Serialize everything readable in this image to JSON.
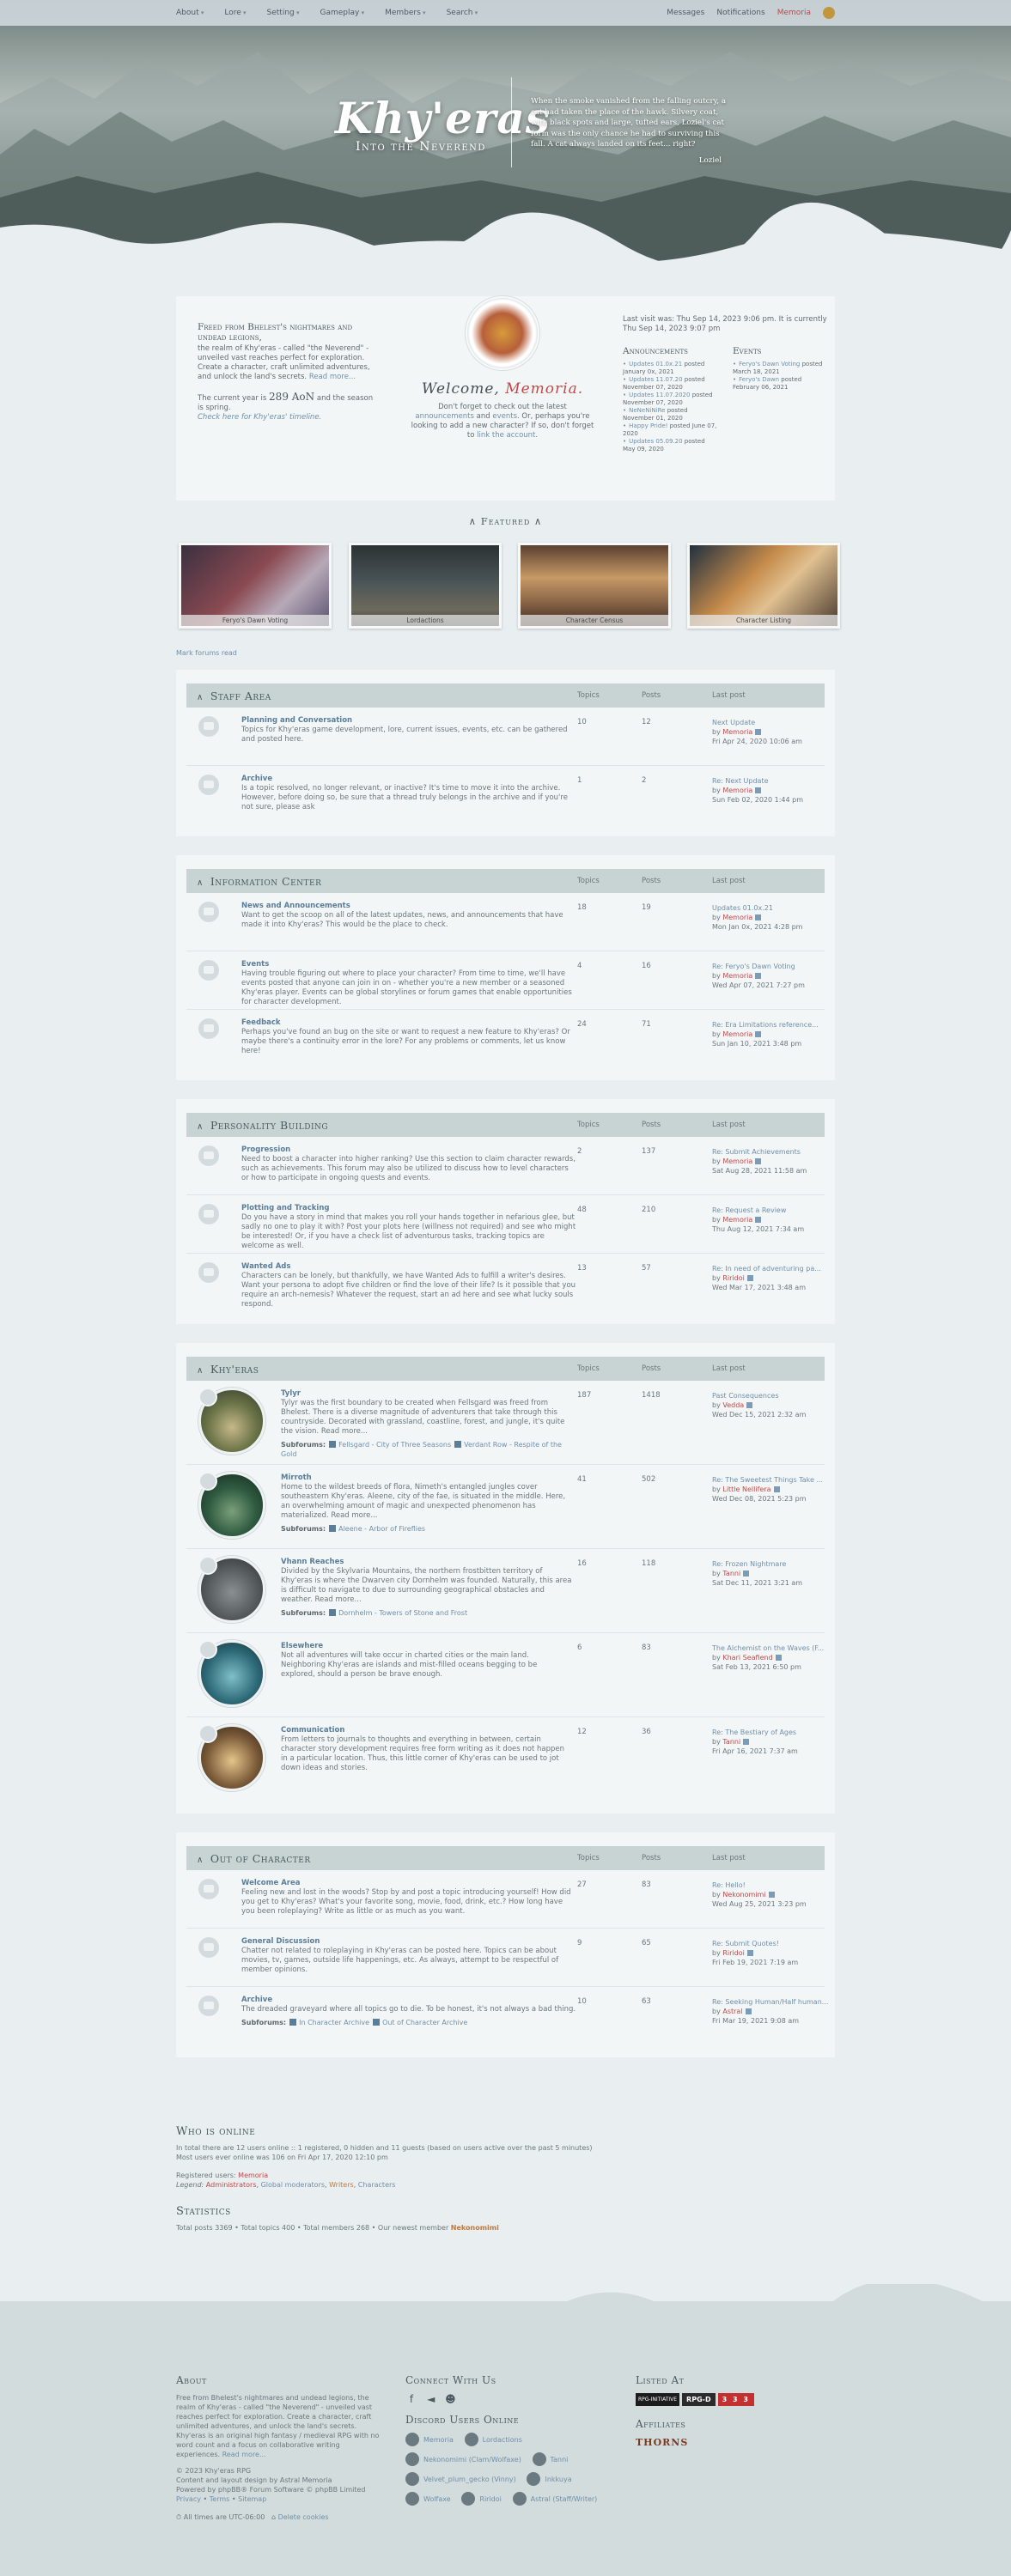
{
  "nav": {
    "left": [
      "About",
      "Lore",
      "Setting",
      "Gameplay",
      "Members",
      "Search"
    ],
    "messages": "Messages",
    "notifications": "Notifications",
    "user": "Memoria"
  },
  "hero": {
    "title": "Khy'eras",
    "subtitle": "Into the Neverend",
    "quote": "When the smoke vanished from the falling outcry, a cat had taken the place of the hawk. Silvery coat, with black spots and large, tufted ears, Loziel's cat form was the only chance he had to surviving this fall. A cat always landed on its feet... right?",
    "quote_author": "Loziel"
  },
  "welcome": {
    "intro_heading": "Freed from Bhelest's nightmares and undead legions,",
    "intro_text": "the realm of Khy'eras - called \"the Neverend\" - unveiled vast reaches perfect for exploration. Create a character, craft unlimited adventures, and unlock the land's secrets.",
    "read_more": "Read more...",
    "year_prefix": "The current year is",
    "year_value": "289 AoN",
    "year_suffix": "and the season is spring.",
    "timeline": "Check here for Khy'eras' timeline.",
    "welcome_word": "Welcome,",
    "welcome_name": "Memoria.",
    "welcome_text_1": "Don't forget to check out the latest",
    "announcements_link": "announcements",
    "and_word": "and",
    "events_link": "events",
    "welcome_text_2": ". Or, perhaps you're looking to add a new character? If so, don't forget to",
    "link_account": "link the account",
    "last_visit": "Last visit was: Thu Sep 14, 2023 9:06 pm. It is currently Thu Sep 14, 2023 9:07 pm",
    "announcements_title": "Announcements",
    "events_title": "Events",
    "announcements": [
      {
        "link": "Updates 01.0x.21",
        "text": "posted January 0x, 2021"
      },
      {
        "link": "Updates 11.07.20",
        "text": "posted November 07, 2020"
      },
      {
        "link": "Updates 11.07.2020",
        "text": "posted November 07, 2020"
      },
      {
        "link": "NeNeNiNiRe",
        "text": "posted November 01, 2020"
      },
      {
        "link": "Happy Pride!",
        "text": "posted June 07, 2020"
      },
      {
        "link": "Updates 05.09.20",
        "text": "posted May 09, 2020"
      }
    ],
    "events": [
      {
        "link": "Feryo's Dawn Voting",
        "text": "posted March 18, 2021"
      },
      {
        "link": "Feryo's Dawn",
        "text": "posted February 06, 2021"
      }
    ]
  },
  "featured": {
    "title": "Featured",
    "cards": [
      "Feryo's Dawn Voting",
      "Lordactions",
      "Character Census",
      "Character Listing"
    ]
  },
  "mark_read": "Mark forums read",
  "columns": {
    "topics": "Topics",
    "posts": "Posts",
    "last": "Last post",
    "subforums": "Subforums:"
  },
  "categories": [
    {
      "title": "Staff Area",
      "forums": [
        {
          "name": "Planning and Conversation",
          "desc": "Topics for Khy'eras game development, lore, current issues, events, etc. can be gathered and posted here.",
          "topics": "10",
          "posts": "12",
          "last_title": "Next Update",
          "by": "by",
          "last_user": "Memoria",
          "last_date": "Fri Apr 24, 2020 10:06 am",
          "subs": []
        },
        {
          "name": "Archive",
          "desc": "Is a topic resolved, no longer relevant, or inactive? It's time to move it into the archive. However, before doing so, be sure that a thread truly belongs in the archive and if you're not sure, please ask",
          "topics": "1",
          "posts": "2",
          "last_title": "Re: Next Update",
          "by": "by",
          "last_user": "Memoria",
          "last_date": "Sun Feb 02, 2020 1:44 pm",
          "subs": []
        }
      ]
    },
    {
      "title": "Information Center",
      "forums": [
        {
          "name": "News and Announcements",
          "desc": "Want to get the scoop on all of the latest updates, news, and announcements that have made it into Khy'eras? This would be the place to check.",
          "topics": "18",
          "posts": "19",
          "last_title": "Updates 01.0x.21",
          "by": "by",
          "last_user": "Memoria",
          "last_date": "Mon Jan 0x, 2021 4:28 pm",
          "subs": []
        },
        {
          "name": "Events",
          "desc": "Having trouble figuring out where to place your character? From time to time, we'll have events posted that anyone can join in on - whether you're a new member or a seasoned Khy'eras player. Events can be global storylines or forum games that enable opportunities for character development.",
          "topics": "4",
          "posts": "16",
          "last_title": "Re: Feryo's Dawn Voting",
          "by": "by",
          "last_user": "Memoria",
          "last_date": "Wed Apr 07, 2021 7:27 pm",
          "subs": []
        },
        {
          "name": "Feedback",
          "desc": "Perhaps you've found an bug on the site or want to request a new feature to Khy'eras? Or maybe there's a continuity error in the lore? For any problems or comments, let us know here!",
          "topics": "24",
          "posts": "71",
          "last_title": "Re: Era Limitations reference...",
          "by": "by",
          "last_user": "Memoria",
          "last_date": "Sun Jan 10, 2021 3:48 pm",
          "subs": []
        }
      ]
    },
    {
      "title": "Personality Building",
      "forums": [
        {
          "name": "Progression",
          "desc": "Need to boost a character into higher ranking? Use this section to claim character rewards, such as achievements. This forum may also be utilized to discuss how to level characters or how to participate in ongoing quests and events.",
          "topics": "2",
          "posts": "137",
          "last_title": "Re: Submit Achievements",
          "by": "by",
          "last_user": "Memoria",
          "last_date": "Sat Aug 28, 2021 11:58 am",
          "subs": []
        },
        {
          "name": "Plotting and Tracking",
          "desc": "Do you have a story in mind that makes you roll your hands together in nefarious glee, but sadly no one to play it with? Post your plots here (willness not required) and see who might be interested! Or, if you have a check list of adventurous tasks, tracking topics are welcome as well.",
          "topics": "48",
          "posts": "210",
          "last_title": "Re: Request a Review",
          "by": "by",
          "last_user": "Memoria",
          "last_date": "Thu Aug 12, 2021 7:34 am",
          "subs": []
        },
        {
          "name": "Wanted Ads",
          "desc": "Characters can be lonely, but thankfully, we have Wanted Ads to fulfill a writer's desires. Want your persona to adopt five children or find the love of their life? Is it possible that you require an arch-nemesis? Whatever the request, start an ad here and see what lucky souls respond.",
          "topics": "13",
          "posts": "57",
          "last_title": "Re: In need of adventuring pa...",
          "by": "by",
          "last_user": "Riridoi",
          "last_date": "Wed Mar 17, 2021 3:48 am",
          "subs": []
        }
      ]
    },
    {
      "title": "Khy'eras",
      "forums": [
        {
          "name": "Tylyr",
          "desc": "Tylyr was the first boundary to be created when Fellsgard was freed from Bhelest. There is a diverse magnitude of adventurers that take through this countryside. Decorated with grassland, coastline, forest, and jungle, it's quite the vision. Read more...",
          "topics": "187",
          "posts": "1418",
          "last_title": "Past Consequences",
          "by": "by",
          "last_user": "Vedda",
          "last_date": "Wed Dec 15, 2021 2:32 am",
          "subs": [
            "Fellsgard - City of Three Seasons",
            "Verdant Row - Respite of the Gold"
          ]
        },
        {
          "name": "Mirroth",
          "desc": "Home to the wildest breeds of flora, Nimeth's entangled jungles cover southeastern Khy'eras. Aleene, city of the fae, is situated in the middle. Here, an overwhelming amount of magic and unexpected phenomenon has materialized. Read more...",
          "topics": "41",
          "posts": "502",
          "last_title": "Re: The Sweetest Things Take ...",
          "by": "by",
          "last_user": "Little Nellifera",
          "last_date": "Wed Dec 08, 2021 5:23 pm",
          "subs": [
            "Aleene - Arbor of Fireflies"
          ]
        },
        {
          "name": "Vhann Reaches",
          "desc": "Divided by the Skylvaria Mountains, the northern frostbitten territory of Khy'eras is where the Dwarven city Dornhelm was founded. Naturally, this area is difficult to navigate to due to surrounding geographical obstacles and weather. Read more...",
          "topics": "16",
          "posts": "118",
          "last_title": "Re: Frozen Nightmare",
          "by": "by",
          "last_user": "Tanni",
          "last_date": "Sat Dec 11, 2021 3:21 am",
          "subs": [
            "Dornhelm - Towers of Stone and Frost"
          ]
        },
        {
          "name": "Elsewhere",
          "desc": "Not all adventures will take occur in charted cities or the main land. Neighboring Khy'eras are islands and mist-filled oceans begging to be explored, should a person be brave enough.",
          "topics": "6",
          "posts": "83",
          "last_title": "The Alchemist on the Waves (F...",
          "by": "by",
          "last_user": "Khari Seafiend",
          "last_date": "Sat Feb 13, 2021 6:50 pm",
          "subs": []
        },
        {
          "name": "Communication",
          "desc": "From letters to journals to thoughts and everything in between, certain character story development requires free form writing as it does not happen in a particular location. Thus, this little corner of Khy'eras can be used to jot down ideas and stories.",
          "topics": "12",
          "posts": "36",
          "last_title": "Re: The Bestiary of Ages",
          "by": "by",
          "last_user": "Tanni",
          "last_date": "Fri Apr 16, 2021 7:37 am",
          "subs": []
        }
      ]
    },
    {
      "title": "Out of Character",
      "forums": [
        {
          "name": "Welcome Area",
          "desc": "Feeling new and lost in the woods? Stop by and post a topic introducing yourself! How did you get to Khy'eras? What's your favorite song, movie, food, drink, etc.? How long have you been roleplaying? Write as little or as much as you want.",
          "topics": "27",
          "posts": "83",
          "last_title": "Re: Hello!",
          "by": "by",
          "last_user": "Nekonomimi",
          "last_date": "Wed Aug 25, 2021 3:23 pm",
          "subs": []
        },
        {
          "name": "General Discussion",
          "desc": "Chatter not related to roleplaying in Khy'eras can be posted here. Topics can be about movies, tv, games, outside life happenings, etc. As always, attempt to be respectful of member opinions.",
          "topics": "9",
          "posts": "65",
          "last_title": "Re: Submit Quotes!",
          "by": "by",
          "last_user": "Riridoi",
          "last_date": "Fri Feb 19, 2021 7:19 am",
          "subs": []
        },
        {
          "name": "Archive",
          "desc": "The dreaded graveyard where all topics go to die. To be honest, it's not always a bad thing.",
          "topics": "10",
          "posts": "63",
          "last_title": "Re: Seeking Human/Half human...",
          "by": "by",
          "last_user": "Astral",
          "last_date": "Fri Mar 19, 2021 9:08 am",
          "subs": [
            "In Character Archive",
            "Out of Character Archive"
          ]
        }
      ]
    }
  ],
  "online": {
    "title": "Who is online",
    "line1": "In total there are 12 users online :: 1 registered, 0 hidden and 11 guests (based on users active over the past 5 minutes)",
    "line2": "Most users ever online was 106 on Fri Apr 17, 2020 12:10 pm",
    "registered_label": "Registered users:",
    "registered_user": "Memoria",
    "legend_label": "Legend:",
    "legend": [
      "Administrators",
      "Global moderators",
      "Writers",
      "Characters"
    ]
  },
  "stats": {
    "title": "Statistics",
    "text": "Total posts 3369 • Total topics 400 • Total members 268 • Our newest member",
    "newest": "Nekonomimi"
  },
  "footer": {
    "about_title": "About",
    "about_text": "Free from Bhelest's nightmares and undead legions, the realm of Khy'eras - called \"the Neverend\" - unveiled vast reaches perfect for exploration. Create a character, craft unlimited adventures, and unlock the land's secrets. Khy'eras is an original high fantasy / medieval RPG with no word count and a focus on collaborative writing experiences.",
    "about_more": "Read more...",
    "copyright": "© 2023 Khy'eras RPG",
    "credits1": "Content and layout design by Astral Memoria",
    "credits2": "Powered by phpBB® Forum Software © phpBB Limited",
    "links": [
      "Privacy",
      "Terms",
      "Sitemap"
    ],
    "timezone": "All times are UTC-06:00",
    "cookies": "Delete cookies",
    "connect_title": "Connect With Us",
    "discord_title": "Discord Users Online",
    "discord_users": [
      "Memoria",
      "Lordactions",
      "Nekonomimi (Clam/Wolfaxe)",
      "Tanni",
      "Velvet_plum_gecko (Vinny)",
      "Inkkuya",
      "Wolfaxe",
      "Riridoi",
      "Astral (Staff/Writer)"
    ],
    "listed_title": "Listed At",
    "listed": [
      "RPG-INITIATIVE",
      "RPG-D",
      "3 3 3"
    ],
    "affiliates_title": "Affiliates",
    "affiliate": "THORNS"
  }
}
